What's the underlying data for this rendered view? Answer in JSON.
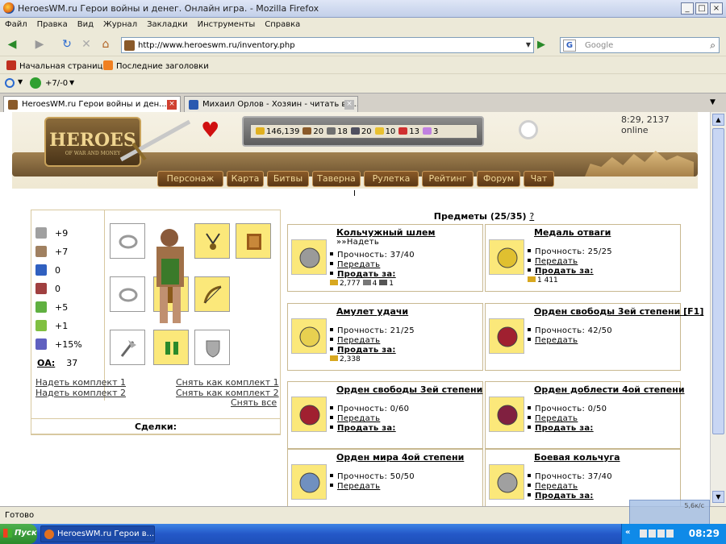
{
  "window": {
    "title": "HeroesWM.ru Герои войны и денег. Онлайн игра. - Mozilla Firefox",
    "controls": [
      "_",
      "□",
      "×"
    ]
  },
  "menu": [
    "Файл",
    "Правка",
    "Вид",
    "Журнал",
    "Закладки",
    "Инструменты",
    "Справка"
  ],
  "address": {
    "url": "http://www.heroeswm.ru/inventory.php",
    "search_placeholder": "Google",
    "search_engine": "G"
  },
  "bookmarks": [
    "Начальная страница",
    "Последние заголовки"
  ],
  "toolbar3": {
    "counter": "+7/-0"
  },
  "tabs": [
    {
      "label": "HeroesWM.ru Герои войны и ден...",
      "active": true
    },
    {
      "label": "Михаил Орлов - Хозяин - читать в б...",
      "active": false
    }
  ],
  "game": {
    "online": "8:29, 2137 online",
    "logo_title": "HEROES",
    "logo_sub": "OF WAR AND MONEY",
    "resources": [
      {
        "icon": "gold-icon",
        "value": "146,139",
        "color": "#e0b020"
      },
      {
        "icon": "wood-icon",
        "value": "20",
        "color": "#8a5a2a"
      },
      {
        "icon": "ore-icon",
        "value": "18",
        "color": "#707070"
      },
      {
        "icon": "mercury-icon",
        "value": "20",
        "color": "#505060"
      },
      {
        "icon": "sulfur-icon",
        "value": "10",
        "color": "#e8c030"
      },
      {
        "icon": "crystal-icon",
        "value": "13",
        "color": "#d03030"
      },
      {
        "icon": "gems-icon",
        "value": "3",
        "color": "#c080e0"
      }
    ],
    "nav": [
      "Персонаж",
      "Карта",
      "Битвы",
      "Таверна",
      "Рулетка",
      "Рейтинг",
      "Форум",
      "Чат"
    ],
    "separator": "I",
    "stats": [
      {
        "icon": "attack-icon",
        "label": "+9",
        "color": "#a0a0a0"
      },
      {
        "icon": "defense-icon",
        "label": "+7",
        "color": "#a08060"
      },
      {
        "icon": "spellpower-icon",
        "label": "0",
        "color": "#3060c0"
      },
      {
        "icon": "knowledge-icon",
        "label": "0",
        "color": "#a04040"
      },
      {
        "icon": "luck-icon",
        "label": "+5",
        "color": "#60b040"
      },
      {
        "icon": "morale-icon",
        "label": "+1",
        "color": "#80c040"
      },
      {
        "icon": "initiative-icon",
        "label": "+15%",
        "color": "#6060c0"
      }
    ],
    "oa": {
      "label": "ОА:",
      "value": "37"
    },
    "kits": {
      "wear1": "Надеть комплект 1",
      "wear2": "Надеть комплект 2",
      "save1": "Снять как комплект 1",
      "save2": "Снять как комплект 2",
      "remove_all": "Снять все"
    },
    "deals": "Сделки:",
    "items_title": "Предметы (25/35)",
    "items_help": "?",
    "items": [
      {
        "name": "Кольчужный шлем",
        "extra": "»»Надеть",
        "durability": "Прочность: 37/40",
        "transfer": "Передать",
        "sell": "Продать за:",
        "cost": "2,777",
        "cost2": "4",
        "cost3": "1",
        "color": "#9a9a9a"
      },
      {
        "name": "Медаль отваги",
        "durability": "Прочность: 25/25",
        "transfer": "Передать",
        "sell": "Продать за:",
        "cost": "1 411",
        "color": "#e0c030"
      },
      {
        "name": "Амулет удачи",
        "durability": "Прочность: 21/25",
        "transfer": "Передать",
        "sell": "Продать за:",
        "cost": "2,338",
        "color": "#e8d050"
      },
      {
        "name": "Орден свободы 3ей степени [F1]",
        "durability": "Прочность: 42/50",
        "transfer": "Передать",
        "color": "#a02030"
      },
      {
        "name": "Орден свободы 3ей степени",
        "durability": "Прочность: 0/60",
        "transfer": "Передать",
        "sell": "Продать за:",
        "color": "#a02030"
      },
      {
        "name": "Орден доблести 4ой степени",
        "durability": "Прочность: 0/50",
        "transfer": "Передать",
        "sell": "Продать за:",
        "color": "#802040"
      },
      {
        "name": "Орден мира 4ой степени",
        "durability": "Прочность: 50/50",
        "transfer": "Передать",
        "color": "#7090c0"
      },
      {
        "name": "Боевая кольчуга",
        "durability": "Прочность: 37/40",
        "transfer": "Передать",
        "sell": "Продать за:",
        "color": "#a0a0a0"
      }
    ]
  },
  "status": "Готово",
  "taskbar": {
    "start": "Пуск",
    "item": "HeroesWM.ru Герои в...",
    "lang": "«",
    "clock": "08:29",
    "popup": "5,6к/с"
  }
}
